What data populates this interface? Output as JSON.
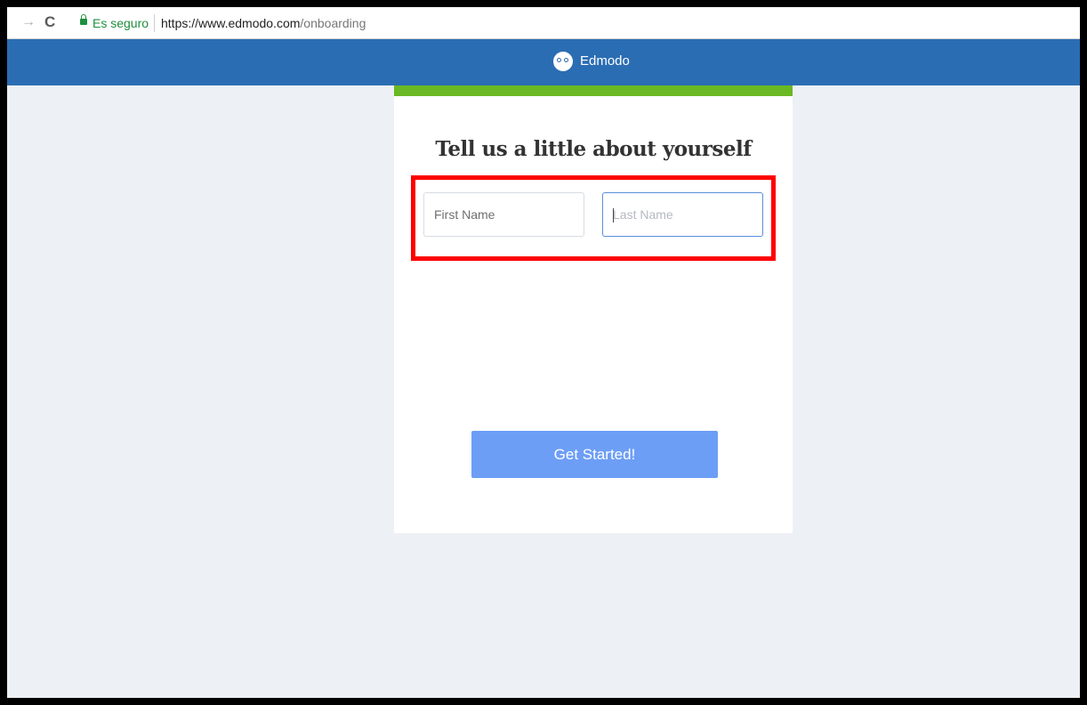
{
  "browser": {
    "secure_label": "Es seguro",
    "url_base": "https://www.edmodo.com",
    "url_path": "/onboarding"
  },
  "topbar": {
    "brand": "Edmodo"
  },
  "form": {
    "title": "Tell us a little about yourself",
    "first_name": {
      "value": "",
      "placeholder": "First Name"
    },
    "last_name": {
      "value": "",
      "placeholder": "Last Name"
    },
    "submit_label": "Get Started!"
  },
  "colors": {
    "topbar": "#2b6db3",
    "accent_bar": "#6ab823",
    "button": "#6d9ef6",
    "highlight": "#ff0000",
    "secure": "#1e8e3e"
  },
  "icons": [
    "forward-arrow-icon",
    "reload-icon",
    "lock-icon",
    "edmodo-logo-icon"
  ]
}
